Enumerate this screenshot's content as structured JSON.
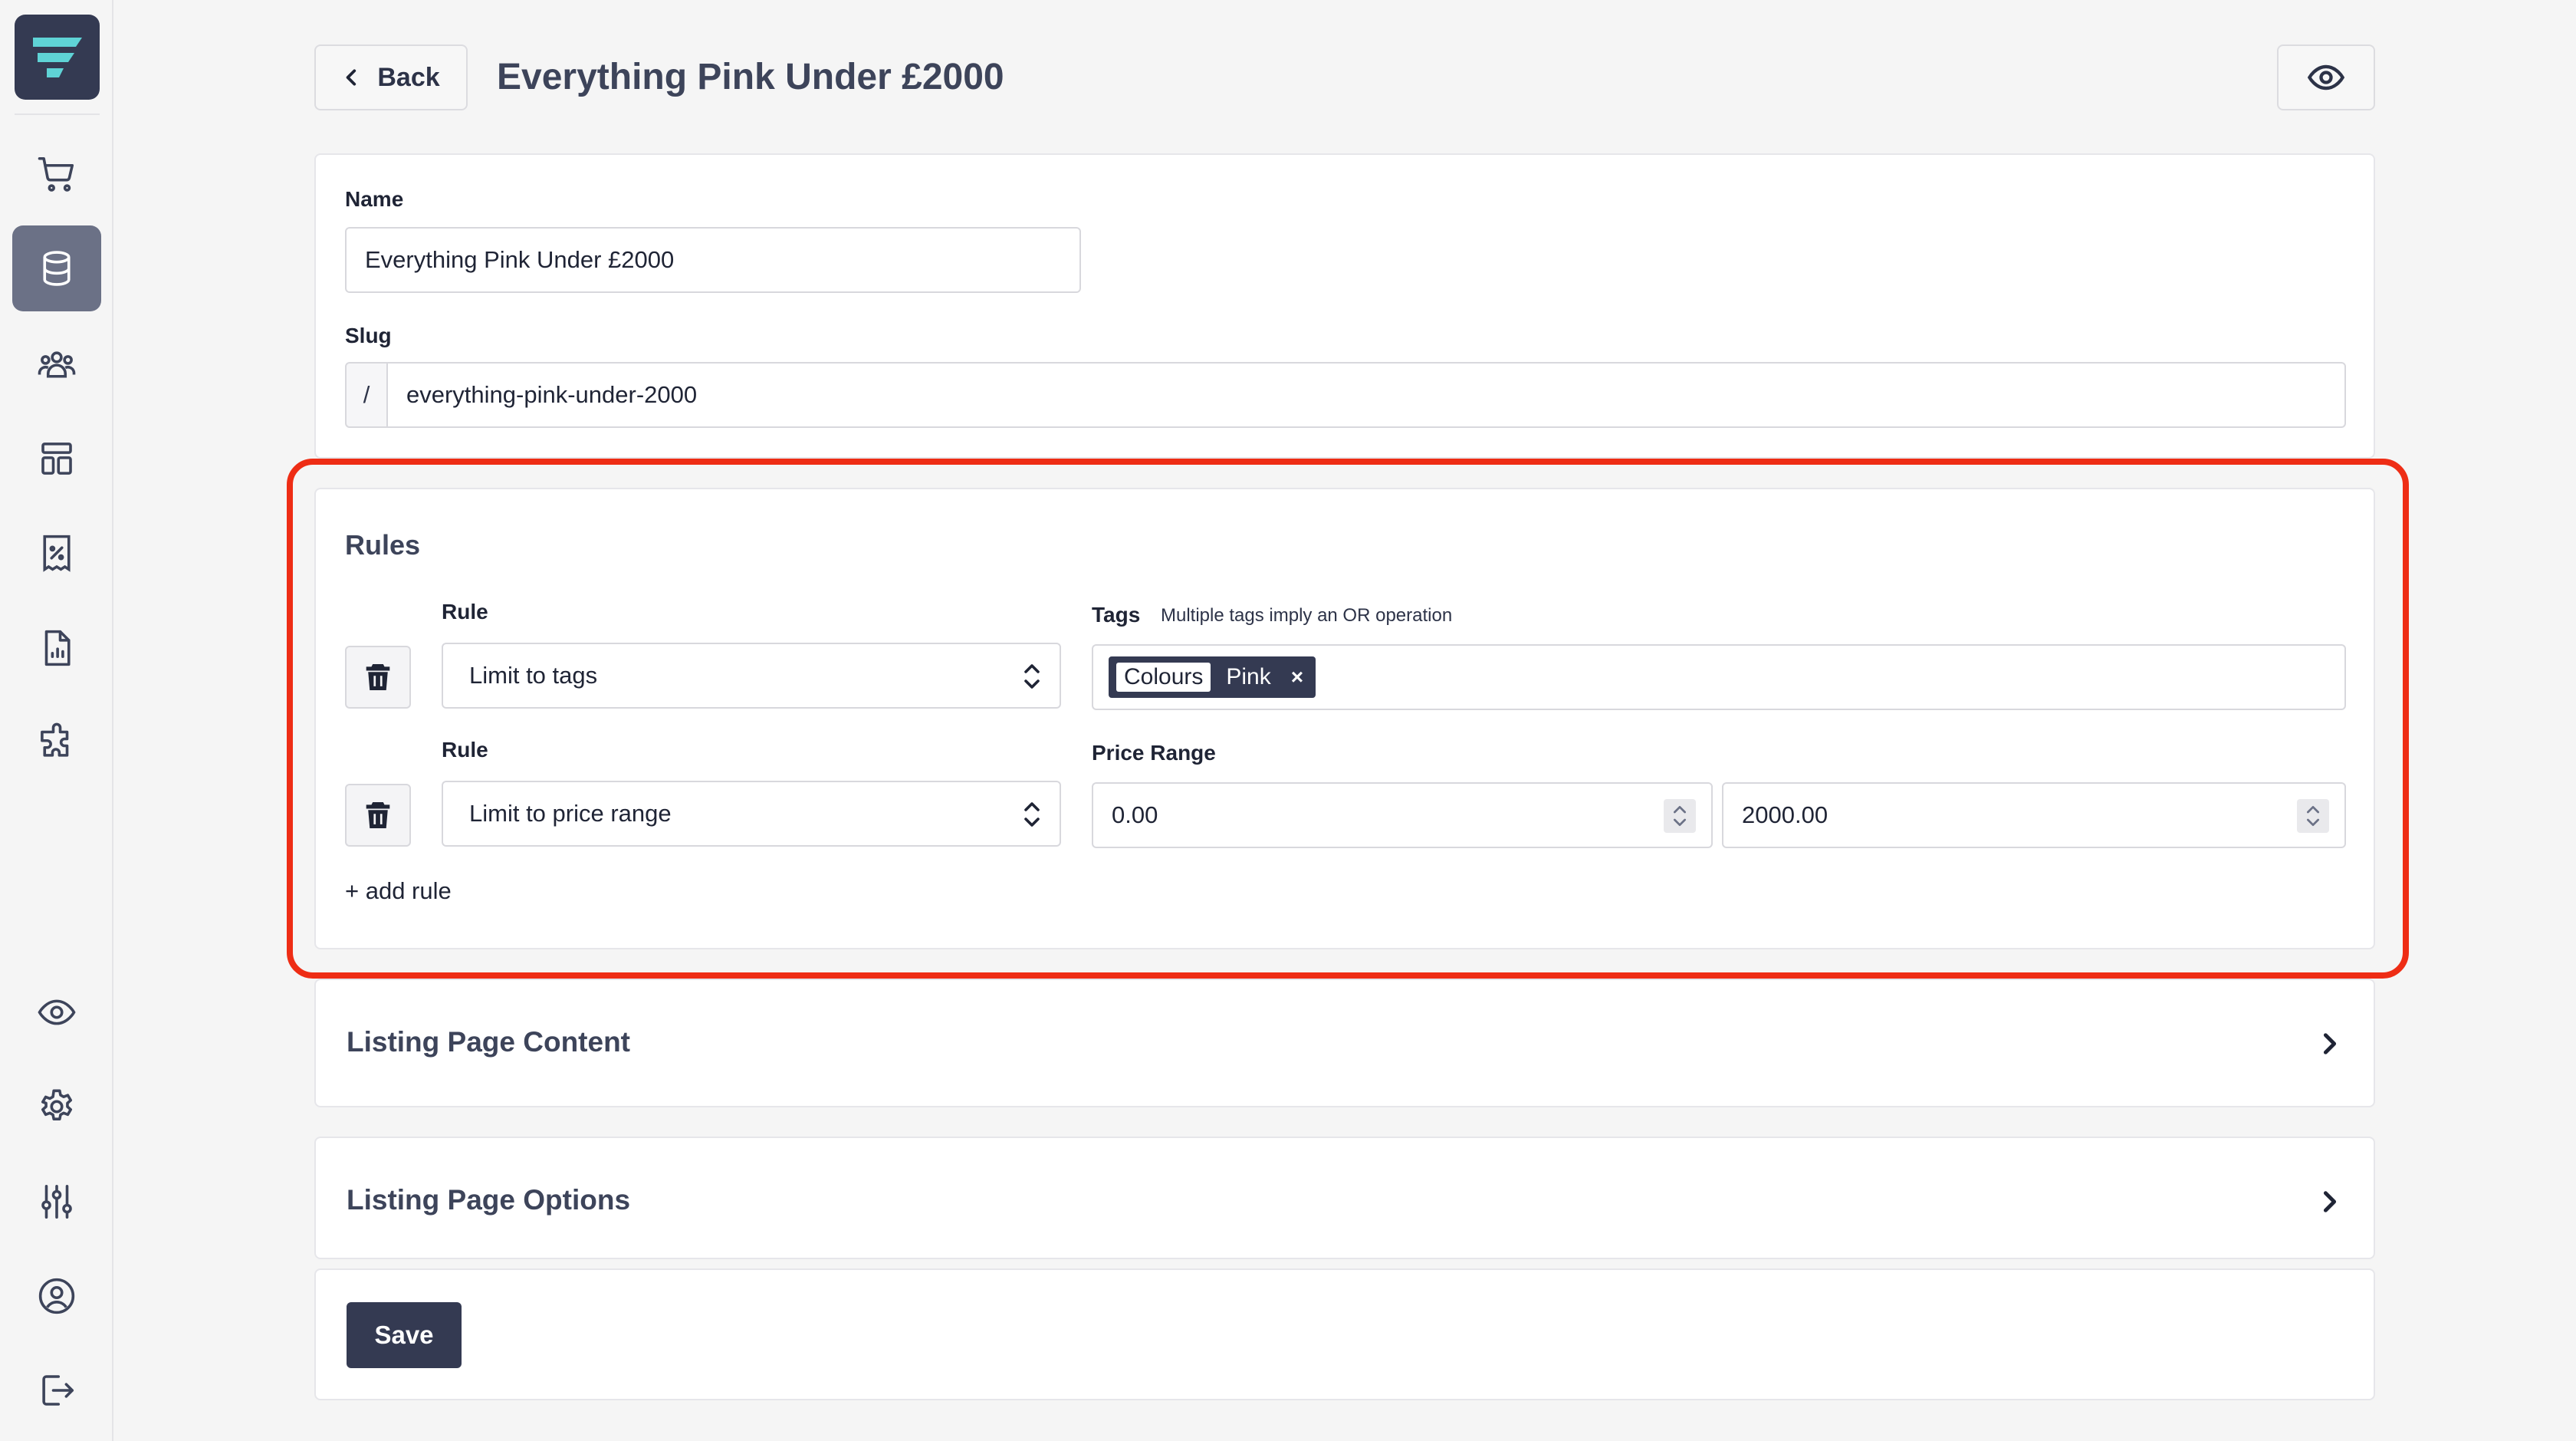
{
  "header": {
    "back_label": "Back",
    "title": "Everything Pink Under £2000",
    "preview_icon": "eye-icon"
  },
  "sidebar": {
    "logo_icon": "app-logo-icon",
    "items": [
      {
        "name": "shop",
        "icon": "cart-icon",
        "active": false
      },
      {
        "name": "database",
        "icon": "database-icon",
        "active": true
      },
      {
        "name": "customers",
        "icon": "users-icon",
        "active": false
      },
      {
        "name": "layouts",
        "icon": "layout-icon",
        "active": false
      },
      {
        "name": "discounts",
        "icon": "percent-receipt-icon",
        "active": false
      },
      {
        "name": "reports",
        "icon": "report-icon",
        "active": false
      },
      {
        "name": "plugins",
        "icon": "puzzle-icon",
        "active": false
      }
    ],
    "bottom_items": [
      {
        "name": "preview",
        "icon": "eye-icon"
      },
      {
        "name": "settings",
        "icon": "gear-icon"
      },
      {
        "name": "adjustments",
        "icon": "sliders-icon"
      },
      {
        "name": "account",
        "icon": "user-circle-icon"
      },
      {
        "name": "logout",
        "icon": "logout-icon"
      }
    ]
  },
  "form": {
    "name_label": "Name",
    "name_value": "Everything Pink Under £2000",
    "slug_label": "Slug",
    "slug_prefix": "/",
    "slug_value": "everything-pink-under-2000"
  },
  "rules": {
    "title": "Rules",
    "items": [
      {
        "rule_label": "Rule",
        "rule_value": "Limit to tags",
        "tags_label": "Tags",
        "tags_hint": "Multiple tags imply an OR operation",
        "tag": {
          "group": "Colours",
          "value": "Pink",
          "remove": "×"
        }
      },
      {
        "rule_label": "Rule",
        "rule_value": "Limit to price range",
        "price_label": "Price Range",
        "price_min": "0.00",
        "price_max": "2000.00"
      }
    ],
    "add_rule": "+ add rule"
  },
  "sections": {
    "listing_content": "Listing Page Content",
    "listing_options": "Listing Page Options"
  },
  "actions": {
    "save": "Save"
  },
  "colors": {
    "accent": "#343a52",
    "highlight": "#ee2d15",
    "logo_mark": "#5fd3d6"
  }
}
